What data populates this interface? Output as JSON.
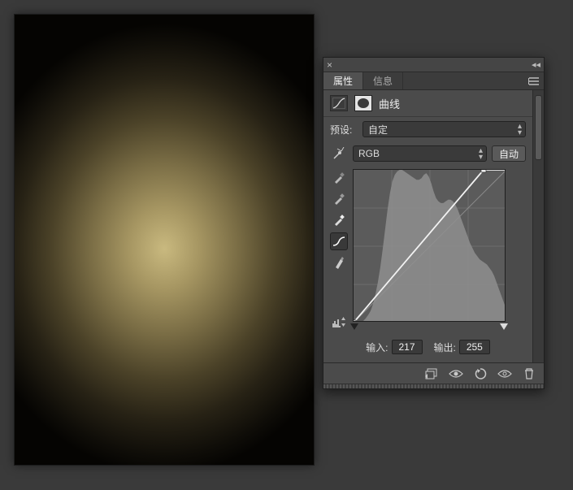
{
  "tabs": {
    "properties": "属性",
    "info": "信息"
  },
  "adjustment": {
    "type_label": "曲线",
    "preset_label": "预设:",
    "preset_value": "自定",
    "channel_value": "RGB",
    "auto_label": "自动"
  },
  "io": {
    "input_label": "输入:",
    "input_value": "217",
    "output_label": "输出:",
    "output_value": "255"
  },
  "curves_chart": {
    "type": "curve",
    "x_range": [
      0,
      255
    ],
    "y_range": [
      0,
      255
    ],
    "grid_divisions": 4,
    "control_points": [
      {
        "in": 0,
        "out": 0
      },
      {
        "in": 217,
        "out": 255
      }
    ],
    "histogram_approx": [
      0,
      0,
      0,
      0,
      2,
      5,
      9,
      14,
      22,
      34,
      48,
      66,
      88,
      112,
      136,
      156,
      170,
      178,
      182,
      184,
      184,
      182,
      180,
      178,
      176,
      174,
      172,
      172,
      174,
      178,
      180,
      176,
      168,
      158,
      150,
      146,
      144,
      144,
      146,
      148,
      148,
      146,
      142,
      136,
      128,
      120,
      112,
      104,
      96,
      90,
      84,
      80,
      76,
      74,
      72,
      70,
      66,
      62,
      56,
      48,
      40,
      32,
      24,
      16
    ],
    "black_point": 0,
    "white_point": 255
  }
}
